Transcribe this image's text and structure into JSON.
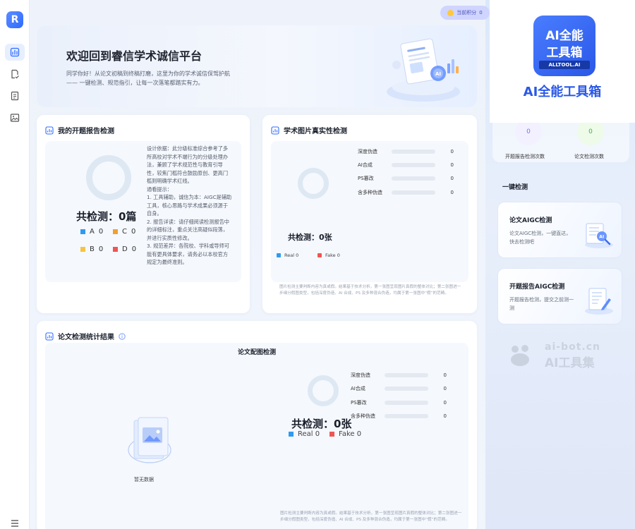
{
  "sidebar": {
    "logo_letter": "R",
    "nav": [
      "dashboard-icon",
      "document-check-icon",
      "report-icon",
      "image-icon"
    ],
    "menu_icon": "menu-icon"
  },
  "header": {
    "points_label": "当前积分",
    "points_value": "0"
  },
  "banner": {
    "title": "欢迎回到睿信学术诚信平台",
    "desc_line1": "同学你好！从论文初稿到终稿打磨，这里为你的学术诚信保驾护航",
    "desc_line2": "—— 一键检测、规范指引，让每一次落笔都踏实有力。"
  },
  "report_card": {
    "title": "我的开题报告检测",
    "total": "共检测：0篇",
    "legend": [
      {
        "label": "A",
        "value": "0",
        "color": "#2f9bf0"
      },
      {
        "label": "C",
        "value": "0",
        "color": "#f0a032"
      },
      {
        "label": "B",
        "value": "0",
        "color": "#f5c542"
      },
      {
        "label": "D",
        "value": "0",
        "color": "#f05454"
      }
    ],
    "text": "设计依据：此分级标准综合参考了多所高校对学术不端行为的分级处理办法，兼顾了学术规范性与教育引导性，较焦门槛符合鼓励原创、更高门槛则明确学术红线。\n通看提示：\n1. 工具辅助，诚信为本：AIGC是辅助工具，核心思路与学术成果必须源于自身。\n2. 报告详读：请仔细阅读检测报告中的详细标注，重点关注高疑似段落，并进行实质性修改。\n3. 规范差异：各院校、学科或导师可能有更具体要求，请务必以本校官方规定为最终准则。"
  },
  "image_card": {
    "title": "学术图片真实性检测",
    "bars": [
      {
        "label": "深度伪造",
        "value": "0"
      },
      {
        "label": "AI合成",
        "value": "0"
      },
      {
        "label": "PS篡改",
        "value": "0"
      },
      {
        "label": "含多种伪造",
        "value": "0"
      }
    ],
    "total": "共检测：0张",
    "legend": [
      {
        "label": "Real 0",
        "color": "#2f9bf0"
      },
      {
        "label": "Fake 0",
        "color": "#f05454"
      }
    ],
    "note": "图片检测主要判断内容为真或假。结果基于技术分析，第一张图呈现图片真假的整体对比；第二张图进一步细分假图类型，包括深度伪造、AI 合成、PS 及多种混合伪造，均属于第一张图中“假”的范畴。"
  },
  "paper_card": {
    "title": "论文检测统计结果",
    "subtitle": "论文配图检测",
    "empty_text": "暂无数据",
    "bars": [
      {
        "label": "深度伪造",
        "value": "0"
      },
      {
        "label": "AI合成",
        "value": "0"
      },
      {
        "label": "PS篡改",
        "value": "0"
      },
      {
        "label": "含多种伪造",
        "value": "0"
      }
    ],
    "total": "共检测：0张",
    "legend": [
      {
        "label": "Real 0",
        "color": "#2f9bf0"
      },
      {
        "label": "Fake 0",
        "color": "#f05454"
      }
    ],
    "note": "图片检测主要判断内容为真或假。结果基于技术分析，第一张图呈现图片真假的整体对比；第二张图进一步细分假图类型，包括深度伪造、AI 合成、PS 及多种混合伪造，均属于第一张图中“假”的范畴。"
  },
  "right_panel": {
    "stats": [
      {
        "value": "0",
        "label": "开题报告检测次数"
      },
      {
        "value": "0",
        "label": "论文检测次数"
      }
    ],
    "one_click_title": "一键检测",
    "features": [
      {
        "title": "论文AIGC检测",
        "desc": "论文AIGC检测，一键直达，快去检测吧"
      },
      {
        "title": "开题报告AIGC检测",
        "desc": "开题报告检测，提交之前测一测"
      }
    ]
  },
  "overlay": {
    "badge_line1": "AI全能",
    "badge_line2": "工具箱",
    "badge_line3": "ALLTOOL.AI",
    "brand_name": "AI全能工具箱",
    "watermark_line1": "ai-bot.cn",
    "watermark_line2": "AI工具集"
  }
}
